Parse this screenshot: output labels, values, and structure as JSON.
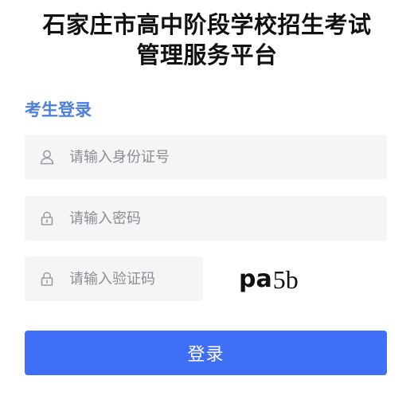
{
  "header": {
    "title_line1": "石家庄市高中阶段学校招生考试",
    "title_line2": "管理服务平台"
  },
  "login": {
    "heading": "考生登录",
    "id_field": {
      "placeholder": "请输入身份证号",
      "value": "",
      "icon": "user-icon"
    },
    "password_field": {
      "placeholder": "请输入密码",
      "value": "",
      "icon": "lock-icon"
    },
    "captcha_field": {
      "placeholder": "请输入验证码",
      "value": "",
      "icon": "lock-icon"
    },
    "captcha_image": {
      "chars": [
        "p",
        "a",
        "5",
        "b"
      ]
    },
    "submit_label": "登录"
  },
  "colors": {
    "accent": "#3f6ff6",
    "heading": "#4a7fe0",
    "field_bg": "#f4f5f7",
    "placeholder": "#8b8d91"
  }
}
